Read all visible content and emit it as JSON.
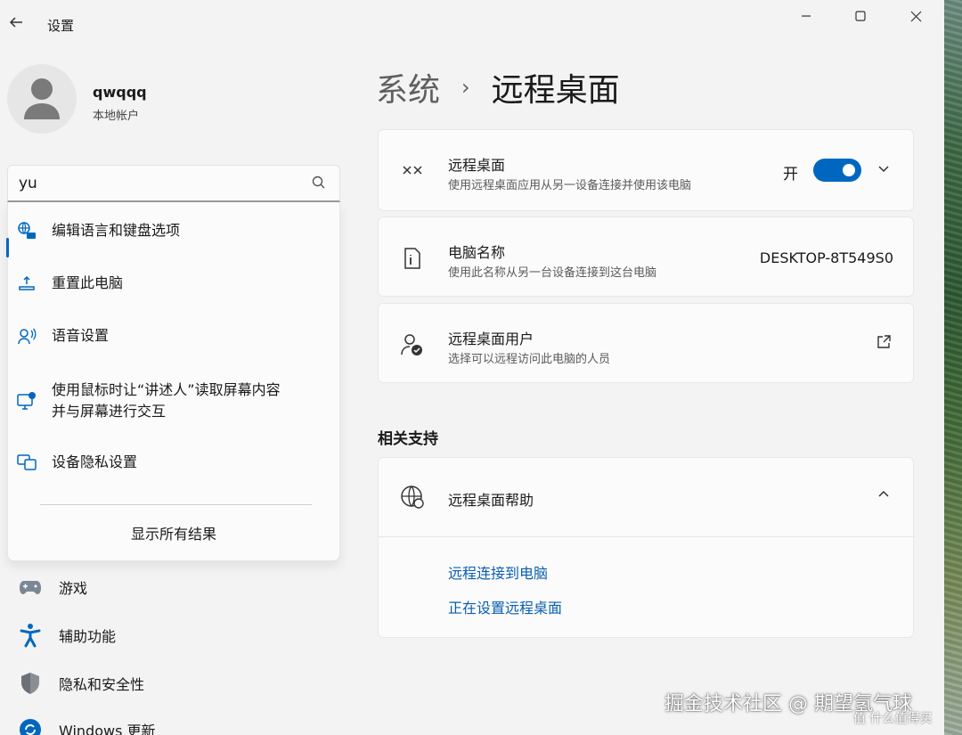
{
  "window": {
    "app_title": "设置",
    "back_icon": "arrow-left-icon",
    "controls": [
      "minimize-icon",
      "maximize-icon",
      "close-icon"
    ]
  },
  "profile": {
    "name": "qwqqq",
    "account_type": "本地帐户"
  },
  "search": {
    "value": "yu",
    "icon": "search-icon"
  },
  "search_results": {
    "items": [
      {
        "label": "编辑语言和键盘选项",
        "icon": "language-keyboard-icon"
      },
      {
        "label": "重置此电脑",
        "icon": "reset-pc-icon"
      },
      {
        "label": "语音设置",
        "icon": "speech-icon"
      },
      {
        "label": "使用鼠标时让“讲述人”读取屏幕内容",
        "label_line2": "并与屏幕进行交互",
        "icon": "narrator-icon"
      },
      {
        "label": "设备隐私设置",
        "icon": "device-privacy-icon"
      }
    ],
    "show_all": "显示所有结果"
  },
  "nav": {
    "items": [
      {
        "label": "游戏",
        "icon": "gamepad-icon"
      },
      {
        "label": "辅助功能",
        "icon": "accessibility-icon"
      },
      {
        "label": "隐私和安全性",
        "icon": "shield-icon"
      },
      {
        "label": "Windows 更新",
        "icon": "windows-update-icon"
      }
    ]
  },
  "breadcrumb": {
    "parent": "系统",
    "separator": "›",
    "current": "远程桌面"
  },
  "cards": {
    "remote_desktop": {
      "title": "远程桌面",
      "subtitle": "使用远程桌面应用从另一设备连接并使用该电脑",
      "toggle_label": "开",
      "toggle_on": true,
      "icon": "remote-desktop-icon"
    },
    "pc_name": {
      "title": "电脑名称",
      "subtitle": "使用此名称从另一台设备连接到这台电脑",
      "value": "DESKTOP-8T549S0",
      "icon": "pc-info-icon"
    },
    "users": {
      "title": "远程桌面用户",
      "subtitle": "选择可以远程访问此电脑的人员",
      "icon": "user-check-icon"
    }
  },
  "related": {
    "section_title": "相关支持",
    "help_title": "远程桌面帮助",
    "links": [
      "远程连接到电脑",
      "正在设置远程桌面"
    ]
  },
  "watermark": {
    "text": "掘金技术社区 @ 期望氢气球",
    "text2": "值 什么值得买"
  },
  "colors": {
    "accent": "#0067c0",
    "link": "#0a5fb0",
    "background": "#f3f3f3",
    "card": "#fbfbfb"
  }
}
